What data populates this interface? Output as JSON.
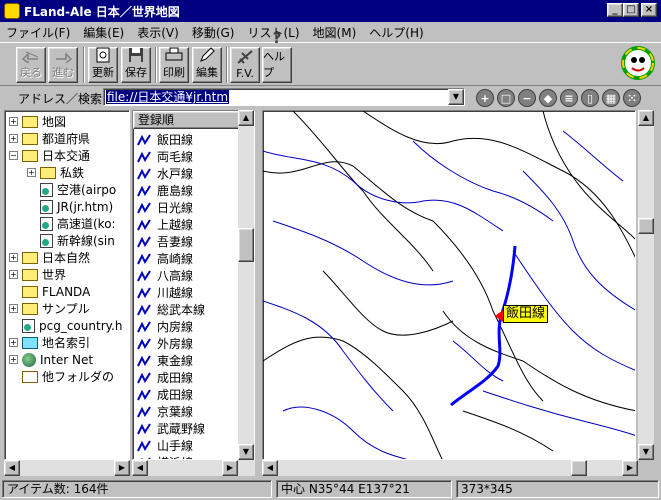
{
  "window": {
    "title": "FLand-Ale 日本／世界地図"
  },
  "menu": [
    "ファイル(F)",
    "編集(E)",
    "表示(V)",
    "移動(G)",
    "リスト(L)",
    "地図(M)",
    "ヘルプ(H)"
  ],
  "toolbar": {
    "back": "戻る",
    "forward": "進む",
    "refresh": "更新",
    "save": "保存",
    "print": "印刷",
    "edit": "編集",
    "fv": "F.V.",
    "help": "ヘルプ"
  },
  "address": {
    "label": "アドレス／検索",
    "value": "file://日本交通¥jr.htm"
  },
  "tree": {
    "items": [
      "地図",
      "都道府県",
      "日本交通",
      "私鉄",
      "空港(airpo",
      "JR(jr.htm)",
      "高速道(ko:",
      "新幹線(sin",
      "日本自然",
      "世界",
      "FLANDA",
      "サンプル",
      "pcg_country.h",
      "地名索引",
      "Inter Net",
      "他フォルダの"
    ]
  },
  "list": {
    "header": "登録順",
    "items": [
      "飯田線",
      "両毛線",
      "水戸線",
      "鹿島線",
      "日光線",
      "上越線",
      "吾妻線",
      "高崎線",
      "八高線",
      "川越線",
      "総武本線",
      "内房線",
      "外房線",
      "東金線",
      "成田線",
      "成田線",
      "京葉線",
      "武蔵野線",
      "山手線",
      "横浜線"
    ]
  },
  "map": {
    "label": "飯田線",
    "accent": "#0000ff"
  },
  "status": {
    "items": "アイテム数: 164件",
    "center": "中心 N35°44 E137°21",
    "size": "373*345"
  }
}
